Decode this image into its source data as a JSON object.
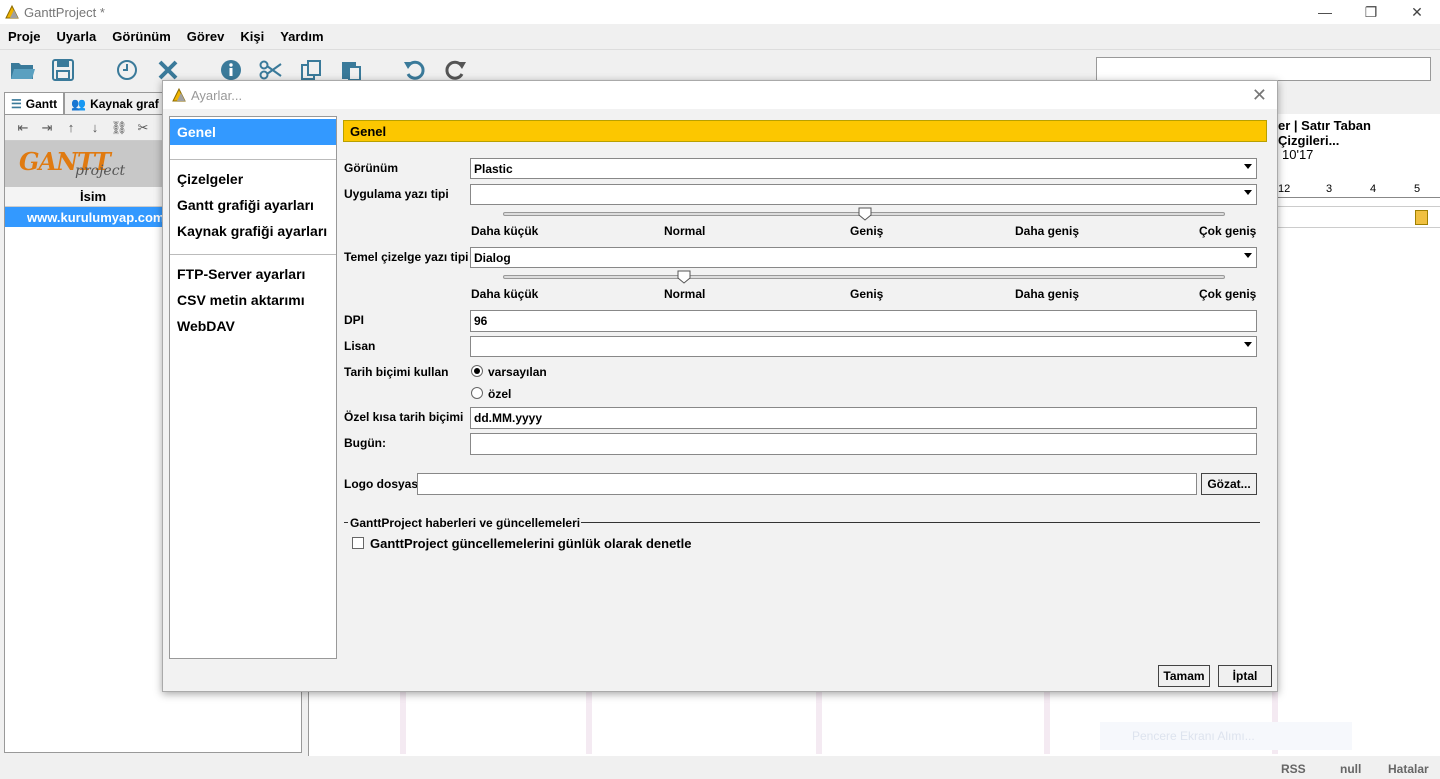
{
  "window": {
    "title": "GanttProject *",
    "controls": [
      "—",
      "❐",
      "✕"
    ]
  },
  "menu": [
    "Proje",
    "Uyarla",
    "Görünüm",
    "Görev",
    "Kişi",
    "Yardım"
  ],
  "tabs": [
    {
      "label": "Gantt"
    },
    {
      "label": "Kaynak graf"
    }
  ],
  "tree": {
    "column": "İsim",
    "rows": [
      {
        "label": "www.kurulumyap.com"
      }
    ],
    "logo": {
      "text": "GANTT",
      "sub": "project"
    }
  },
  "gantt": {
    "header_right": "er  |  Satır Taban Çizgileri...",
    "year_label": "10'17",
    "days": [
      "12",
      "3",
      "4",
      "5"
    ]
  },
  "notification_ghost": "Pencere Ekranı Alımı...",
  "status": {
    "rss": "RSS",
    "null": "null",
    "errors": "Hatalar"
  },
  "dialog": {
    "title": "Ayarlar...",
    "nav": {
      "group1": [
        "Genel"
      ],
      "group2": [
        "Çizelgeler",
        "Gantt grafiği ayarları",
        "Kaynak grafiği ayarları"
      ],
      "group3": [
        "FTP-Server ayarları",
        "CSV metin aktarımı",
        "WebDAV"
      ]
    },
    "section_title": "Genel",
    "fields": {
      "appearance_label": "Görünüm",
      "appearance_value": "Plastic",
      "app_font_label": "Uygulama yazı tipi",
      "app_font_value": "",
      "chart_font_label": "Temel çizelge yazı tipi",
      "chart_font_value": "Dialog",
      "dpi_label": "DPI",
      "dpi_value": "96",
      "locale_label": "Lisan",
      "locale_value": "",
      "date_format_label": "Tarih biçimi kullan",
      "date_default": "varsayılan",
      "date_custom": "özel",
      "short_date_label": "Özel kısa tarih biçimi",
      "short_date_value": "dd.MM.yyyy",
      "today_label": "Bugün:",
      "today_value": "",
      "logo_label": "Logo dosyası",
      "logo_value": "",
      "browse_label": "Gözat..."
    },
    "slider_ticks": [
      "Daha küçük",
      "Normal",
      "Geniş",
      "Daha geniş",
      "Çok geniş"
    ],
    "sliders": {
      "app_font_level": 3,
      "chart_font_level": 2
    },
    "date_format_selected": "varsayılan",
    "updates": {
      "group_title": "GanttProject haberleri ve güncellemeleri",
      "check_label": "GanttProject güncellemelerini günlük olarak denetle",
      "checked": false
    },
    "buttons": {
      "ok": "Tamam",
      "cancel": "İptal"
    }
  },
  "colors": {
    "accent": "#3399ff",
    "section_header": "#fcc700"
  }
}
